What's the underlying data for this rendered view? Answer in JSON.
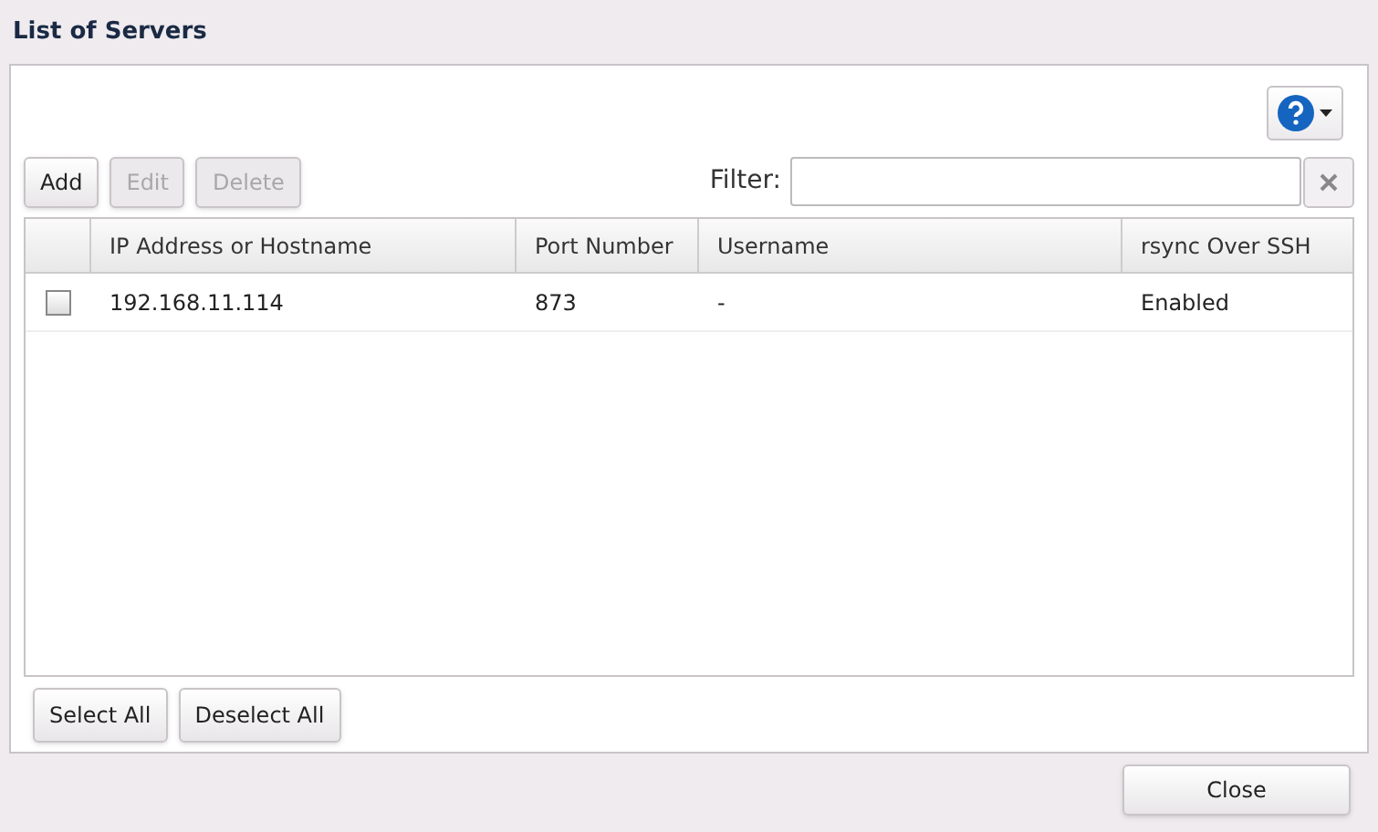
{
  "window": {
    "title": "List of Servers"
  },
  "toolbar": {
    "buttons": [
      {
        "label": "Add",
        "disabled": false
      },
      {
        "label": "Edit",
        "disabled": true
      },
      {
        "label": "Delete",
        "disabled": true
      }
    ],
    "filter": {
      "label": "Filter:"
    }
  },
  "table": {
    "columns": [
      "IP Address or Hostname",
      "Port Number",
      "Username",
      "rsync Over SSH"
    ],
    "rows": [
      {
        "checked": false,
        "cells": [
          "192.168.11.114",
          "873",
          "-",
          "Enabled"
        ]
      }
    ]
  },
  "selection_buttons": [
    "Select All",
    "Deselect All"
  ],
  "footer": {
    "close": "Close"
  }
}
